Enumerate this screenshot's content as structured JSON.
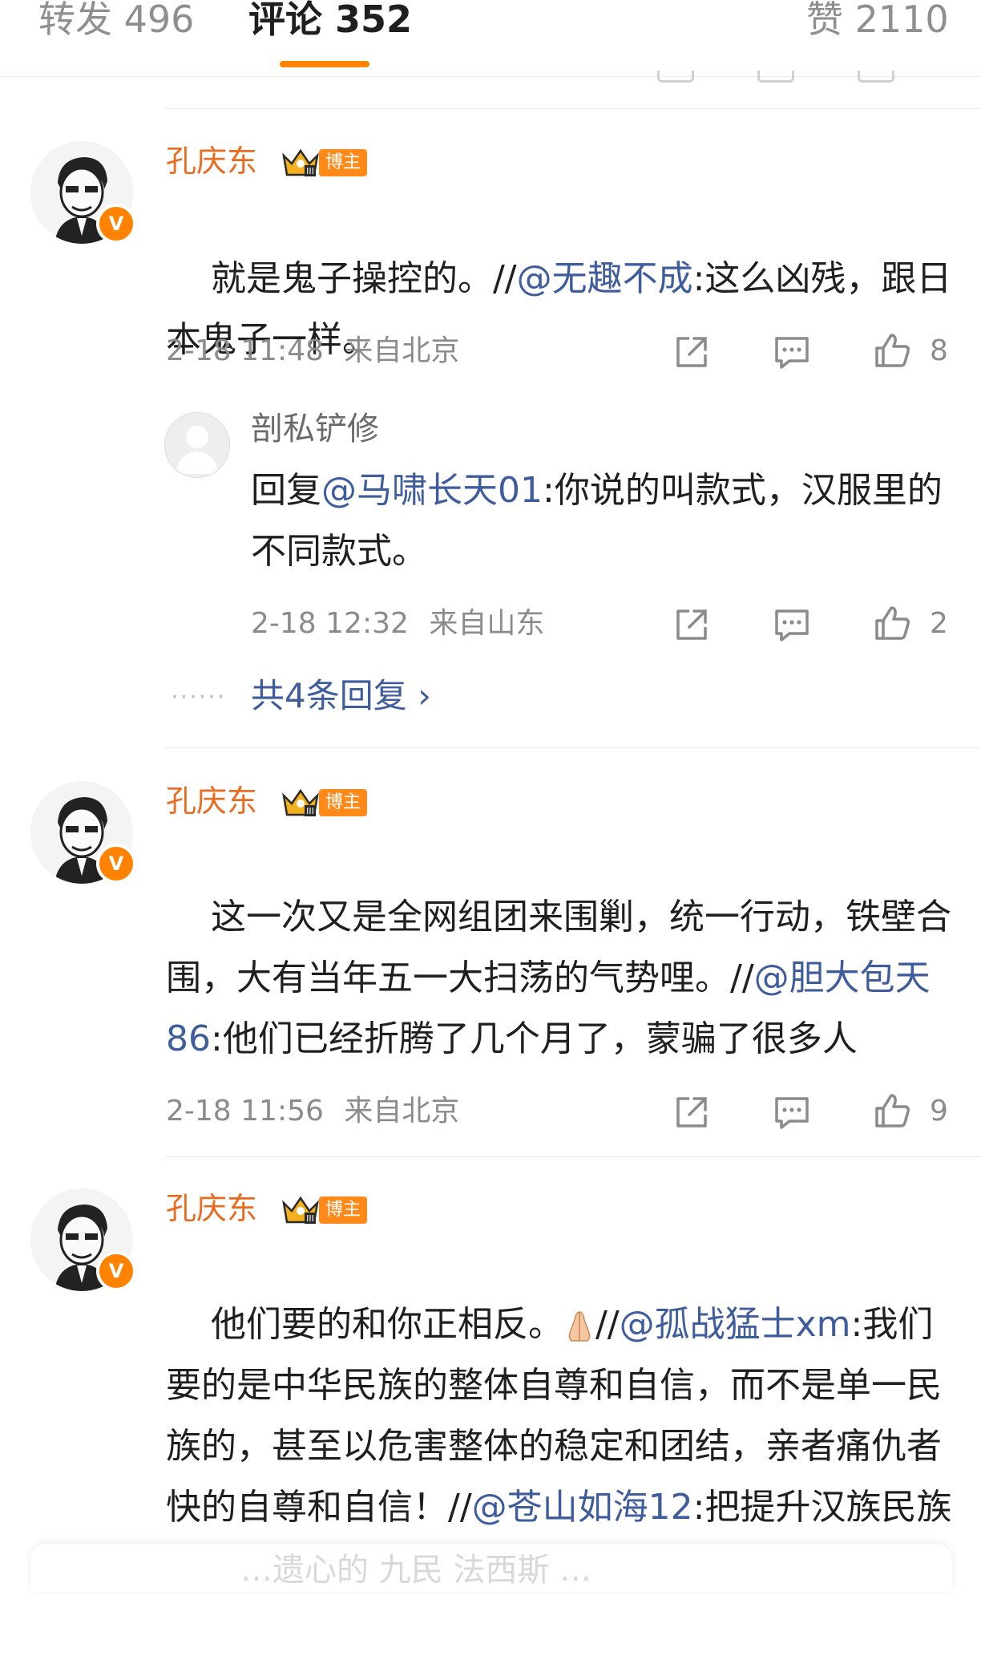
{
  "tabs": {
    "repost": "转发 496",
    "comments": "评论 352",
    "likes": "赞 2110"
  },
  "blogger_tag": "博主",
  "comments": [
    {
      "author": "孔庆东",
      "text_before": "就是鬼子操控的。//",
      "mention": "@无趣不成",
      "text_after": ":这么凶残，跟日本鬼子一样。",
      "time": "2-18 11:48",
      "location": "来自北京",
      "likes": "8",
      "reply": {
        "author": "剖私铲修",
        "text_before": "回复",
        "mention": "@马啸长天01",
        "text_after": ":你说的叫款式，汉服里的不同款式。",
        "time": "2-18 12:32",
        "location": "来自山东",
        "likes": "2"
      },
      "dots": "······",
      "more_replies": "共4条回复 ›"
    },
    {
      "author": "孔庆东",
      "text_before": "这一次又是全网组团来围剿，统一行动，铁壁合围，大有当年五一大扫荡的气势哩。//",
      "mention": "@胆大包天86",
      "text_after": ":他们已经折腾了几个月了，蒙骗了很多人",
      "time": "2-18 11:56",
      "location": "来自北京",
      "likes": "9"
    },
    {
      "author": "孔庆东",
      "text_before": "他们要的和你正相反。",
      "text_mid": "//",
      "mention": "@孤战猛士xm",
      "text_after": ":我们要的是中华民族的整体自尊和自信，而不是单一民族的，甚至以危害整体的稳定和团结，亲者痛仇者快的自尊和自信！//",
      "mention2": "@苍山如海12",
      "text_after2": ":把提升汉族民族自信心、民"
    }
  ],
  "bottom_ghost_text": "…遗心的 九民 法西斯 …"
}
